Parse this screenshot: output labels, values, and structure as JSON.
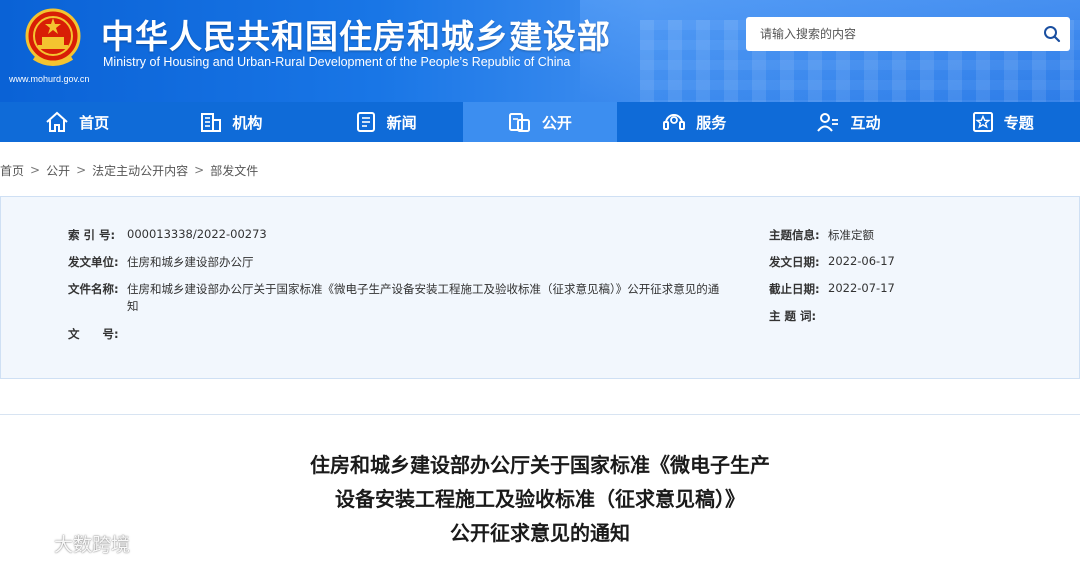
{
  "header": {
    "title": "中华人民共和国住房和城乡建设部",
    "subtitle": "Ministry of Housing and Urban-Rural Development of the People’s Republic of China",
    "url": "www.mohurd.gov.cn",
    "search_placeholder": "请输入搜索的内容"
  },
  "nav": {
    "items": [
      {
        "label": "首页",
        "icon": "home-icon"
      },
      {
        "label": "机构",
        "icon": "building-icon"
      },
      {
        "label": "新闻",
        "icon": "news-icon"
      },
      {
        "label": "公开",
        "icon": "disclosure-icon",
        "active": true
      },
      {
        "label": "服务",
        "icon": "service-icon"
      },
      {
        "label": "互动",
        "icon": "interaction-icon"
      },
      {
        "label": "专题",
        "icon": "topic-icon"
      }
    ]
  },
  "breadcrumb": {
    "items": [
      "首页",
      "公开",
      "法定主动公开内容",
      "部发文件"
    ],
    "separator": ">"
  },
  "info": {
    "index_label": "索 引 号:",
    "index_value": "000013338/2022-00273",
    "issuer_label": "发文单位:",
    "issuer_value": "住房和城乡建设部办公厅",
    "doc_name_label": "文件名称:",
    "doc_name_value_line1": "住房和城乡建设部办公厅关于国家标准《微电子生产设备安装工程施工及验收标准（征求意见稿）》公开征求意见的通",
    "doc_name_value_line2": "知",
    "doc_no_label": "文　　号:",
    "doc_no_value": "",
    "subject_info_label": "主题信息:",
    "subject_info_value": "标准定额",
    "issue_date_label": "发文日期:",
    "issue_date_value": "2022-06-17",
    "deadline_label": "截止日期:",
    "deadline_value": "2022-07-17",
    "keywords_label": "主 题 词:",
    "keywords_value": ""
  },
  "article": {
    "title_line1": "住房和城乡建设部办公厅关于国家标准《微电子生产",
    "title_line2": "设备安装工程施工及验收标准（征求意见稿）》",
    "title_line3": "公开征求意见的通知"
  },
  "watermark": {
    "text": "大数跨境"
  },
  "colors": {
    "header_blue": "#1976e6",
    "nav_blue": "#0f6bd8",
    "nav_active": "#3c8ef0",
    "panel_bg": "#f2f7fd"
  }
}
